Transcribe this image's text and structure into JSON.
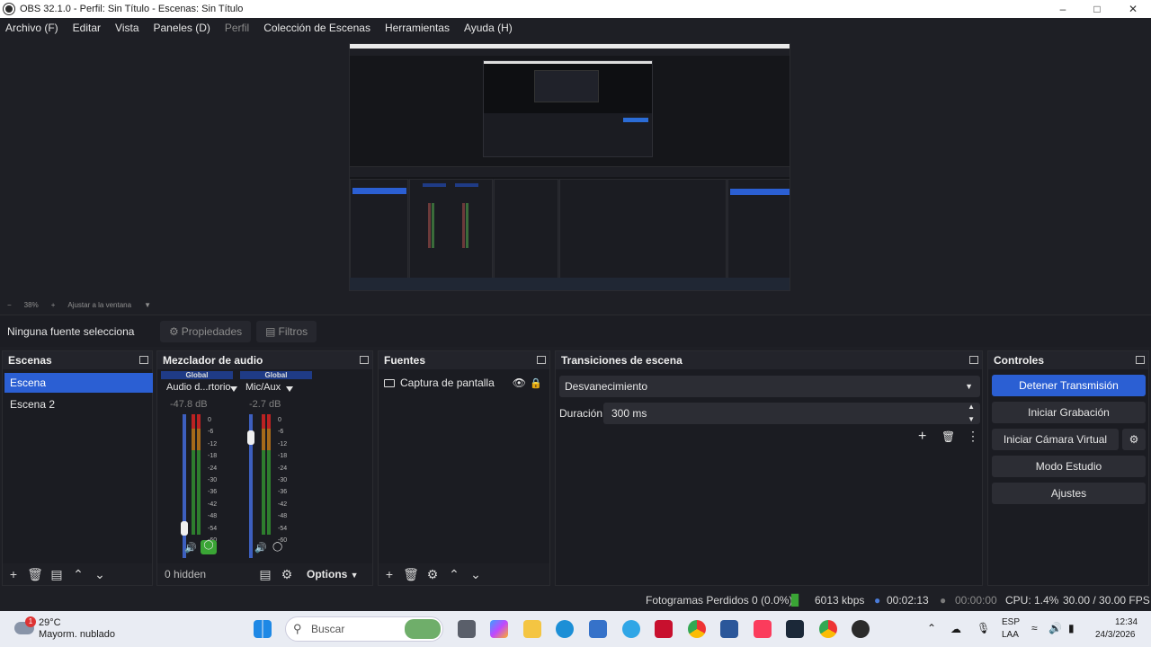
{
  "titlebar": {
    "title": "OBS 32.1.0 - Perfil: Sin Título - Escenas: Sin Título",
    "minimize_icon": "minimize-icon",
    "maximize_icon": "maximize-icon",
    "close_icon": "close-icon"
  },
  "menu": {
    "archivo": "Archivo (F)",
    "editar": "Editar",
    "vista": "Vista",
    "paneles": "Paneles (D)",
    "perfil": "Perfil",
    "coleccion": "Colección de Escenas",
    "herramientas": "Herramientas",
    "ayuda": "Ayuda (H)"
  },
  "zoombar": {
    "minus": "−",
    "zoom": "38%",
    "plus": "+",
    "fit": "Ajustar a la ventana"
  },
  "source_toolbar": {
    "no_source": "Ninguna fuente selecciona",
    "properties": "Propiedades",
    "filters": "Filtros"
  },
  "scenes": {
    "title": "Escenas",
    "items": [
      "Escena",
      "Escena 2"
    ],
    "selected_index": 0
  },
  "mixer": {
    "title": "Mezclador de audio",
    "channels": [
      {
        "badge": "Global",
        "name": "Audio d...rtorio",
        "db": "-47.8 dB",
        "fader_level": 0.22
      },
      {
        "badge": "Global",
        "name": "Mic/Aux",
        "db": "-2.7 dB",
        "fader_level": 0.88
      }
    ],
    "scale": [
      "0",
      "-6",
      "-12",
      "-18",
      "-24",
      "-30",
      "-36",
      "-42",
      "-48",
      "-54",
      "-60"
    ],
    "hidden": "0 hidden",
    "options": "Options"
  },
  "sources": {
    "title": "Fuentes",
    "items": [
      {
        "name": "Captura de pantalla"
      }
    ]
  },
  "transitions": {
    "title": "Transiciones de escena",
    "type": "Desvanecimiento",
    "duration_label": "Duración",
    "duration_value": "300 ms"
  },
  "controls": {
    "title": "Controles",
    "stop_stream": "Detener Transmisión",
    "start_record": "Iniciar Grabación",
    "start_vcam": "Iniciar Cámara Virtual",
    "studio": "Modo Estudio",
    "settings": "Ajustes"
  },
  "status": {
    "dropped": "Fotogramas Perdidos 0 (0.0%)",
    "kbps": "6013 kbps",
    "stream_time": "00:02:13",
    "record_time": "00:00:00",
    "cpu": "CPU: 1.4%",
    "fps": "30.00 / 30.00 FPS"
  },
  "taskbar": {
    "weather_badge": "1",
    "temp": "29°C",
    "weather": "Mayorm. nublado",
    "search": "Buscar",
    "lang1": "ESP",
    "lang2": "LAA",
    "time": "12:34",
    "date": "24/3/2026"
  },
  "colors": {
    "accent": "#2b5fd3",
    "background": "#1e1f25",
    "dock": "#1b1c22"
  }
}
